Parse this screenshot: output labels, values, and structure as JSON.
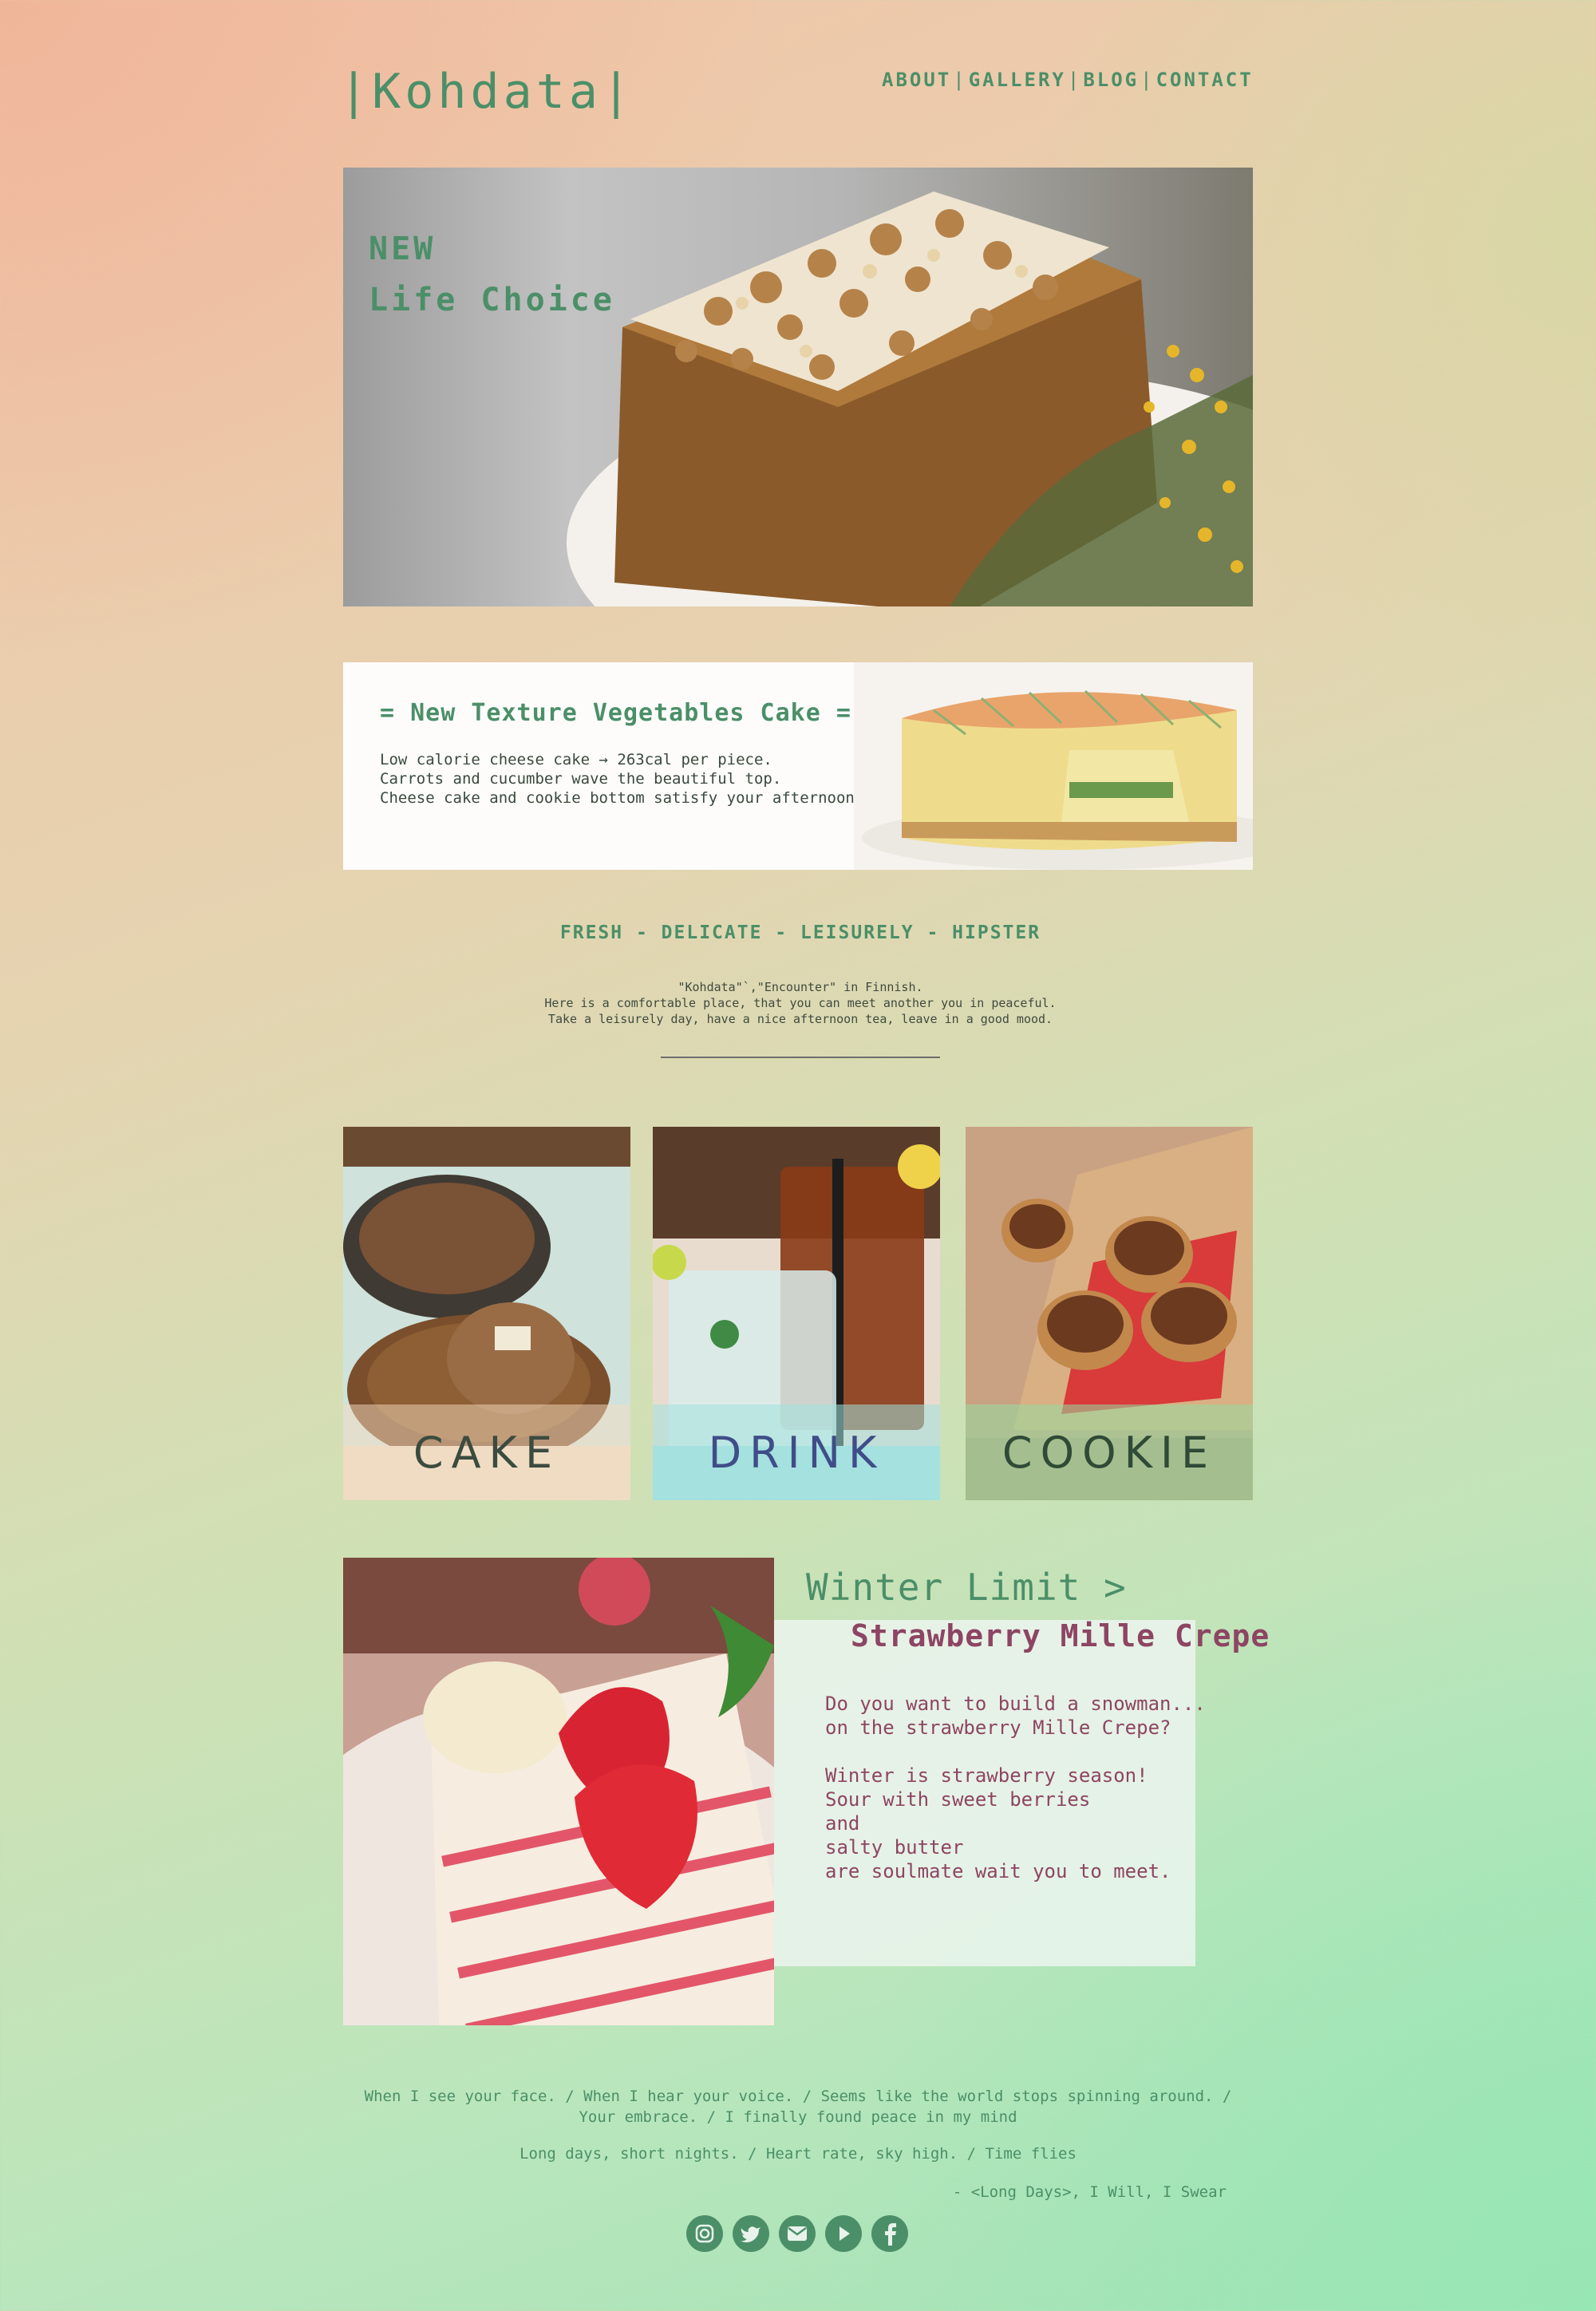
{
  "brand": {
    "logo": "|Kohdata|"
  },
  "nav": {
    "about": "ABOUT",
    "gallery": "GALLERY",
    "blog": "BLOG",
    "contact": "CONTACT",
    "sep": "|"
  },
  "hero": {
    "title": "NEW\nLife Choice"
  },
  "feature": {
    "title": "= New Texture Vegetables Cake =",
    "lines": [
      "Low calorie cheese cake → 263cal per piece.",
      "Carrots and cucumber wave the beautiful top.",
      "Cheese cake and cookie bottom satisfy your afternoon."
    ]
  },
  "tagline": "FRESH - DELICATE - LEISURELY - HIPSTER",
  "intro": [
    "\"Kohdata\"`,\"Encounter\" in Finnish.",
    "Here is a comfortable place, that you can meet another you in peaceful.",
    "Take a leisurely day, have a nice afternoon tea, leave in a good mood."
  ],
  "gallery": [
    {
      "label": "CAKE"
    },
    {
      "label": "DRINK"
    },
    {
      "label": "COOKIE"
    }
  ],
  "winter": {
    "title": "Winter Limit >",
    "subtitle": "Strawberry Mille Crepe",
    "body": "Do you want to build a snowman...\non the strawberry Mille Crepe?\n\nWinter is strawberry season!\nSour with sweet berries\nand\nsalty butter\nare soulmate wait you to meet."
  },
  "footer": {
    "lyric1": "When I see your face. / When I hear your voice. / Seems like the world stops spinning around. / Your embrace. / I finally found peace in my mind",
    "lyric2": "Long days, short nights. / Heart rate, sky high. / Time flies",
    "credit": "- <Long Days>, I Will, I Swear"
  },
  "socials": [
    "instagram-icon",
    "twitter-icon",
    "mail-icon",
    "play-icon",
    "facebook-icon"
  ],
  "colors": {
    "accent": "#4b8f68",
    "berry": "#8d4563"
  }
}
